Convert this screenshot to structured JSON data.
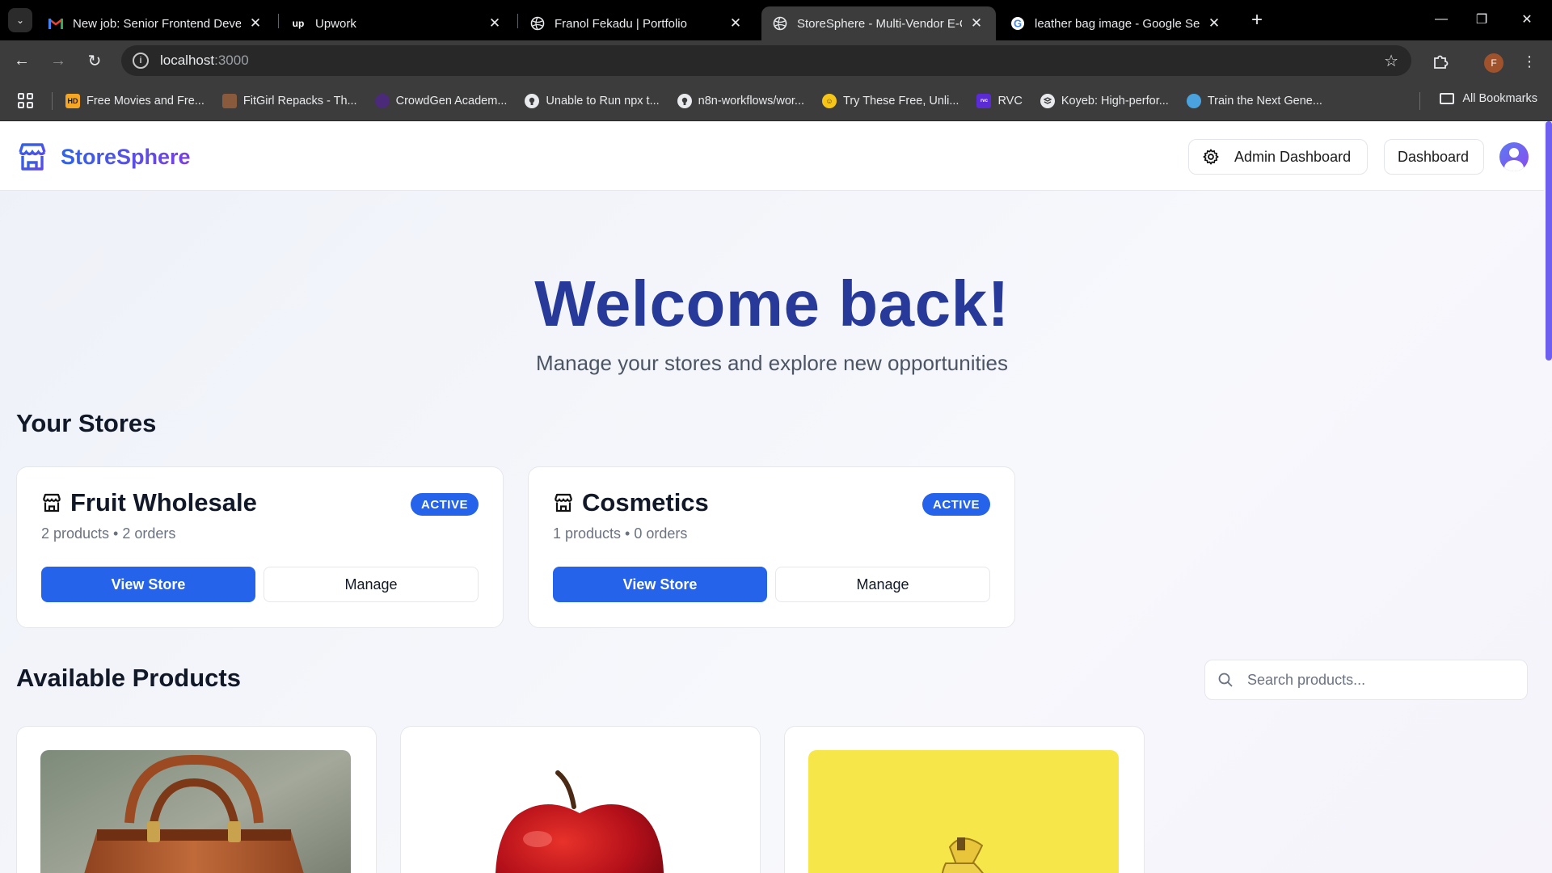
{
  "browser": {
    "tabs": [
      {
        "title": "New job: Senior Frontend Devel",
        "icon": "gmail-icon",
        "active": false
      },
      {
        "title": "Upwork",
        "icon": "upwork-icon",
        "active": false
      },
      {
        "title": "Franol Fekadu | Portfolio",
        "icon": "globe-icon",
        "active": false
      },
      {
        "title": "StoreSphere - Multi-Vendor E-C",
        "icon": "globe-icon",
        "active": true
      },
      {
        "title": "leather bag image - Google Sea",
        "icon": "google-icon",
        "active": false
      }
    ],
    "url_host": "localhost",
    "url_port": ":3000",
    "profile_initial": "F",
    "bookmarks": [
      {
        "label": "Free Movies and Fre...",
        "icon": "hd-icon",
        "color": "#f5a623",
        "glyph": "HD"
      },
      {
        "label": "FitGirl Repacks - Th...",
        "icon": "fitgirl-icon",
        "color": "#8a5a3c",
        "glyph": ""
      },
      {
        "label": "CrowdGen Academ...",
        "icon": "crowdgen-icon",
        "color": "#4b2a7a",
        "glyph": ""
      },
      {
        "label": "Unable to Run npx t...",
        "icon": "github-icon",
        "color": "#e8eaed",
        "glyph": ""
      },
      {
        "label": "n8n-workflows/wor...",
        "icon": "github-icon",
        "color": "#e8eaed",
        "glyph": ""
      },
      {
        "label": "Try These Free, Unli...",
        "icon": "emoji-icon",
        "color": "#f5c518",
        "glyph": ""
      },
      {
        "label": "RVC",
        "icon": "rvc-icon",
        "color": "#5b2bd6",
        "glyph": "RVC"
      },
      {
        "label": "Koyeb: High-perfor...",
        "icon": "koyeb-icon",
        "color": "#e8eaed",
        "glyph": ""
      },
      {
        "label": "Train the Next Gene...",
        "icon": "train-icon",
        "color": "#4aa3df",
        "glyph": ""
      }
    ],
    "all_bookmarks": "All Bookmarks"
  },
  "header": {
    "brand": "StoreSphere",
    "admin_dashboard": "Admin Dashboard",
    "dashboard": "Dashboard"
  },
  "hero": {
    "title": "Welcome back!",
    "subtitle": "Manage your stores and explore new opportunities"
  },
  "stores": {
    "section_title": "Your Stores",
    "items": [
      {
        "name": "Fruit Wholesale",
        "status": "ACTIVE",
        "meta": "2 products • 2 orders",
        "view": "View Store",
        "manage": "Manage"
      },
      {
        "name": "Cosmetics",
        "status": "ACTIVE",
        "meta": "1 products • 0 orders",
        "view": "View Store",
        "manage": "Manage"
      }
    ]
  },
  "products": {
    "section_title": "Available Products",
    "search_placeholder": "Search products...",
    "items": [
      {
        "image": "leather-bag-image"
      },
      {
        "image": "red-apple-image"
      },
      {
        "image": "banana-image"
      }
    ]
  },
  "colors": {
    "accent": "#2563eb",
    "brand_gradient_start": "#2f63e8",
    "brand_gradient_end": "#7a3fe4",
    "hero_title": "#273a9a"
  }
}
